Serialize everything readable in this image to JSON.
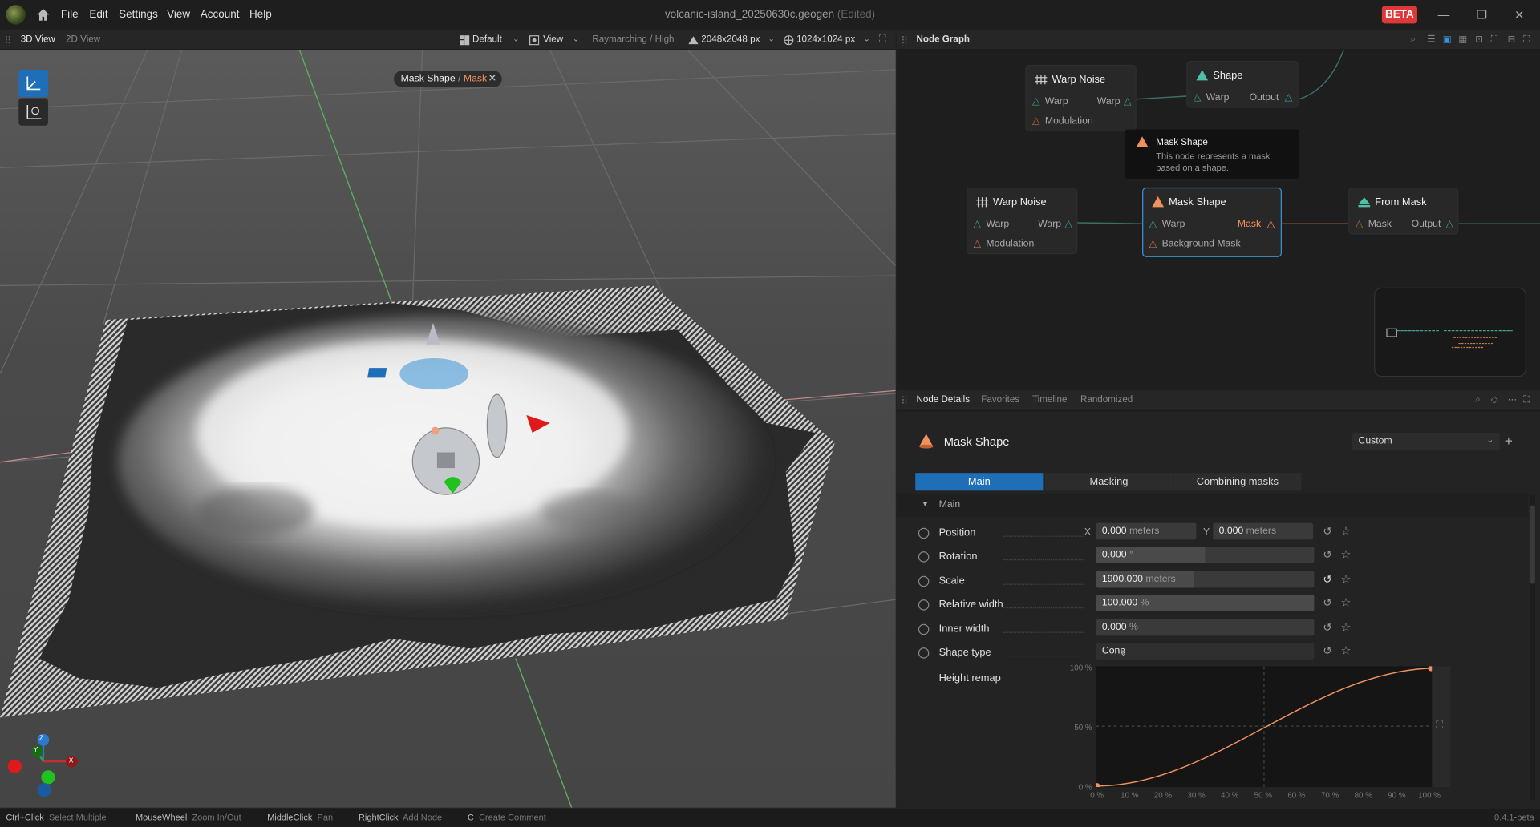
{
  "window": {
    "title": "volcanic-island_20250630c.geogen",
    "edited": "(Edited)",
    "badge": "BETA",
    "menu": [
      "File",
      "Edit",
      "Settings",
      "View",
      "Account",
      "Help"
    ]
  },
  "viewport": {
    "tabs": [
      "3D View",
      "2D View"
    ],
    "toolbar": {
      "layout": "Default",
      "view": "View",
      "render": "Raymarching / High",
      "resolution": "2048x2048 px",
      "preview_res": "1024x1024 px"
    },
    "breadcrumb": {
      "node": "Mask Shape",
      "sep": " / ",
      "output": "Mask"
    },
    "axes": {
      "z": "Z",
      "y": "Y",
      "x": "X"
    }
  },
  "nodegraph": {
    "title": "Node Graph",
    "nodes": [
      {
        "title": "Warp Noise",
        "in1": "Warp",
        "out1": "Warp",
        "in2": "Modulation"
      },
      {
        "title": "Shape",
        "in1": "Warp",
        "out1": "Output"
      },
      {
        "title": "Warp Noise",
        "in1": "Warp",
        "out1": "Warp",
        "in2": "Modulation"
      },
      {
        "title": "Mask Shape",
        "in1": "Warp",
        "out1": "Mask",
        "in2": "Background Mask"
      },
      {
        "title": "From Mask",
        "in1": "Mask",
        "out1": "Output"
      }
    ],
    "tooltip": {
      "title": "Mask Shape",
      "desc": "This node represents a mask based on a shape."
    }
  },
  "details": {
    "tabs": [
      "Node Details",
      "Favorites",
      "Timeline",
      "Randomized"
    ],
    "node_name": "Mask Shape",
    "preset": "Custom",
    "subtabs": [
      "Main",
      "Masking",
      "Combining masks"
    ],
    "section": "Main",
    "params": {
      "position": {
        "label": "Position",
        "x_label": "X",
        "x": "0.000",
        "y_label": "Y",
        "y": "0.000",
        "unit": "meters"
      },
      "rotation": {
        "label": "Rotation",
        "value": "0.000",
        "unit": "°",
        "level": 0.5
      },
      "scale": {
        "label": "Scale",
        "value": "1900.000",
        "unit": "meters",
        "level": 0.45
      },
      "relative_width": {
        "label": "Relative width",
        "value": "100.000",
        "unit": "%"
      },
      "inner_width": {
        "label": "Inner width",
        "value": "0.000",
        "unit": "%"
      },
      "shape_type": {
        "label": "Shape type",
        "value": "Cone"
      },
      "height_remap": {
        "label": "Height remap"
      }
    },
    "curve": {
      "y_ticks": [
        "100 %",
        "50 %",
        "0 %"
      ],
      "x_ticks": [
        "0 %",
        "10 %",
        "20 %",
        "30 %",
        "40 %",
        "50 %",
        "60 %",
        "70 %",
        "80 %",
        "90 %",
        "100 %"
      ]
    }
  },
  "statusbar": {
    "hints": [
      {
        "key": "Ctrl+Click",
        "action": "Select Multiple"
      },
      {
        "key": "MouseWheel",
        "action": "Zoom In/Out"
      },
      {
        "key": "MiddleClick",
        "action": "Pan"
      },
      {
        "key": "RightClick",
        "action": "Add Node"
      },
      {
        "key": "C",
        "action": "Create Comment"
      }
    ],
    "version": "0.4.1-beta"
  },
  "colors": {
    "accent": "#1f6fb8",
    "output_port": "#f0915e",
    "badge": "#e03838"
  }
}
